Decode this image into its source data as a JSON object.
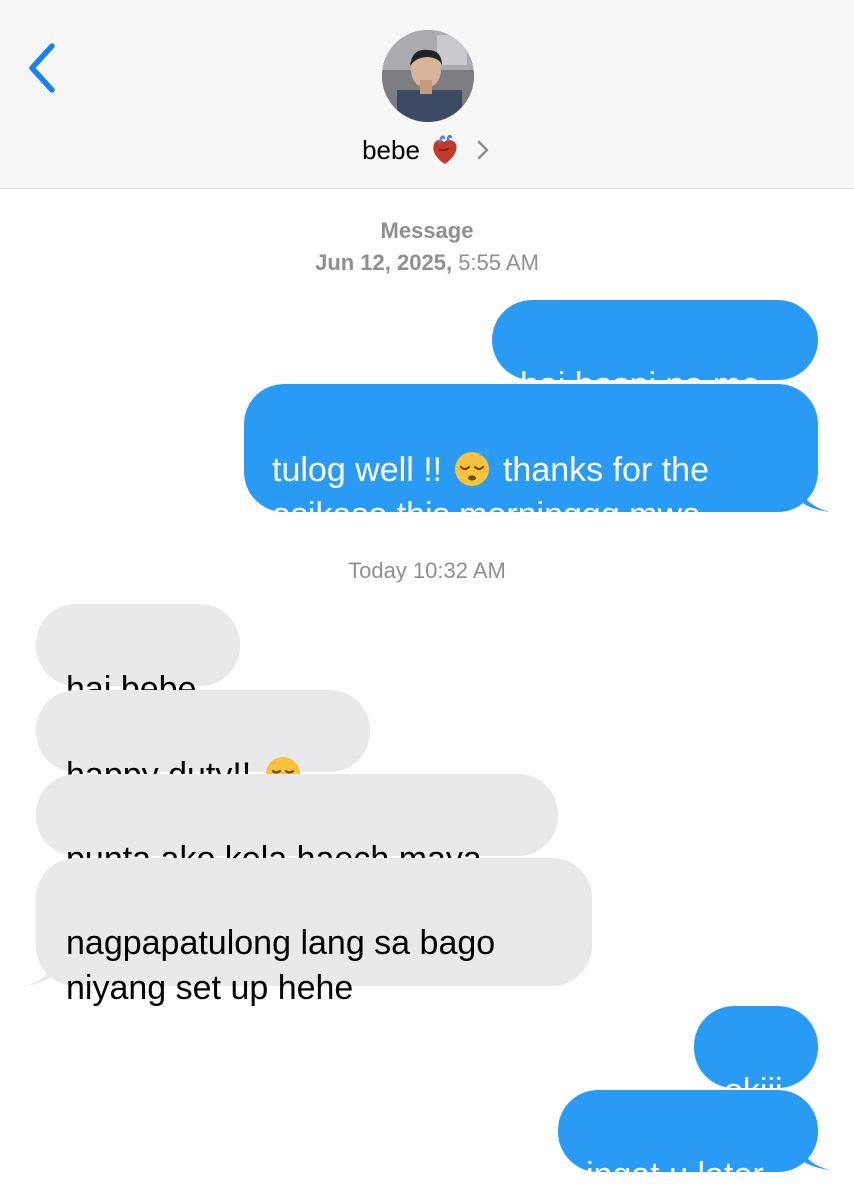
{
  "header": {
    "contact_name": "bebe",
    "contact_emoji": "anatomical-heart-icon"
  },
  "thread": {
    "service_label": "Message",
    "first_date": "Jun 12, 2025,",
    "first_time": "5:55 AM",
    "second_stamp": "Today 10:32 AM"
  },
  "messages": [
    {
      "from": "me",
      "text": "hai hospi na me"
    },
    {
      "from": "me",
      "text_before": "tulog well !! ",
      "emoji": "sleeping-face-icon",
      "text_after": " thanks for the\nasikaso this morninggg mwa"
    },
    {
      "from": "them",
      "text": "hai bebe"
    },
    {
      "from": "them",
      "text": "happy duty!! ",
      "emoji": "kissing-face-icon"
    },
    {
      "from": "them",
      "text": "punta ako kela haech maya"
    },
    {
      "from": "them",
      "text": "nagpapatulong lang sa bago\nniyang set up hehe"
    },
    {
      "from": "me",
      "text": "okiii"
    },
    {
      "from": "me",
      "text": "ingat u later"
    }
  ],
  "colors": {
    "outgoing": "#2a9bf5",
    "incoming": "#e9e9eb",
    "accent": "#1a82f0",
    "timestamp": "#8e8e93"
  }
}
